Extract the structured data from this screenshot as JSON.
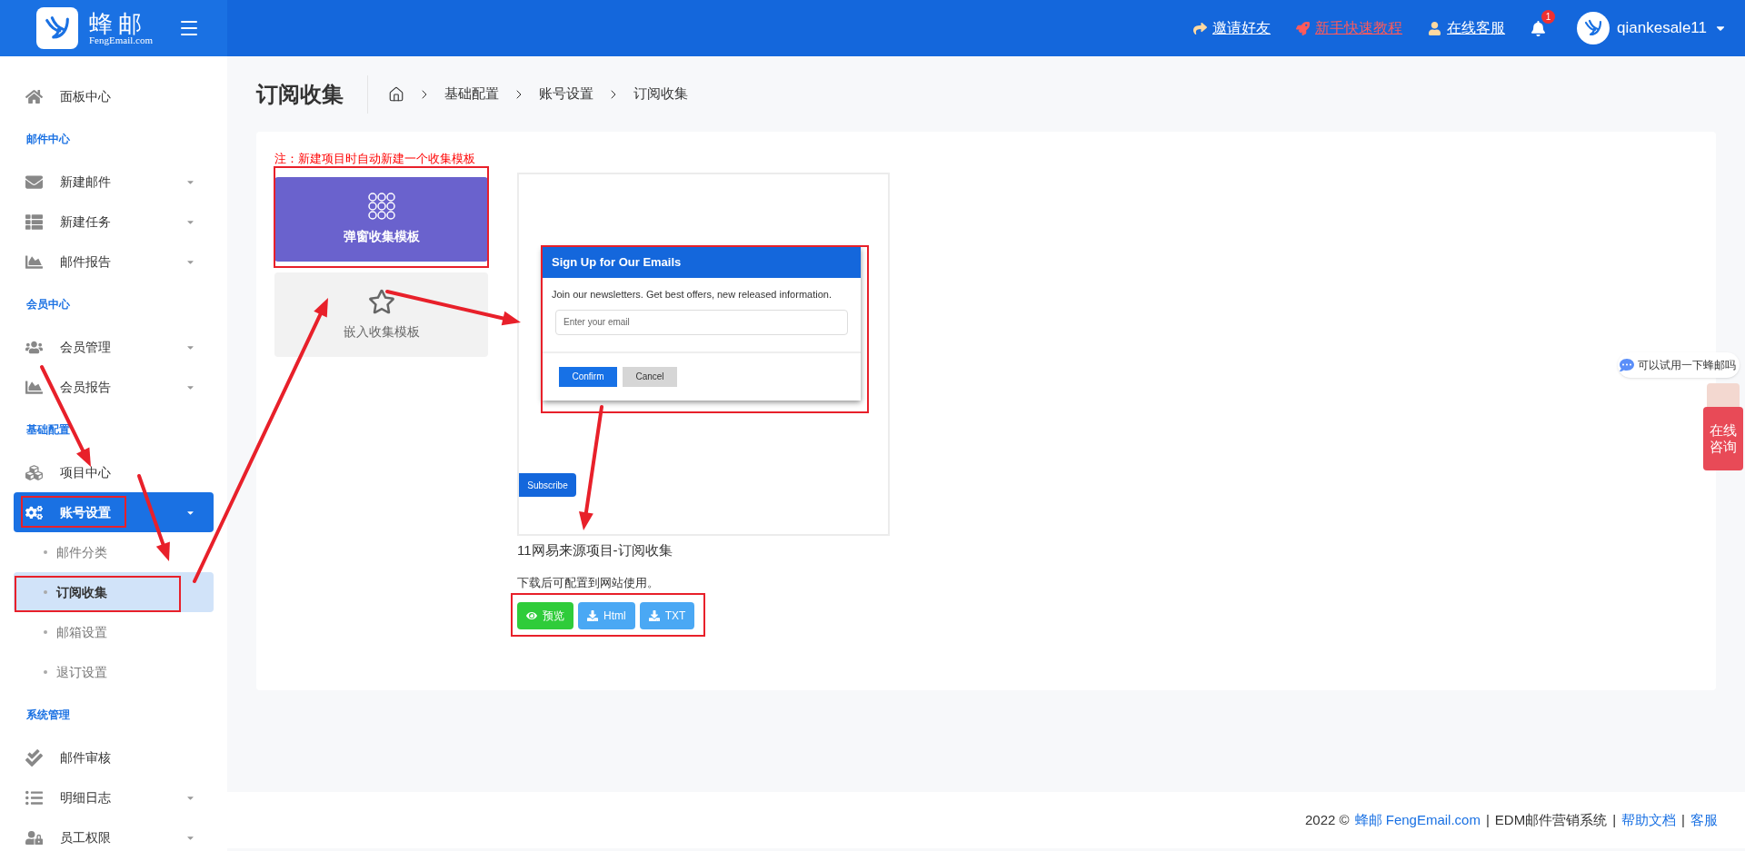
{
  "header": {
    "logo_title": "蜂邮",
    "logo_subtitle": "FengEmail.com",
    "links": [
      {
        "label": "邀请好友",
        "highlighted": false
      },
      {
        "label": "新手快速教程",
        "highlighted": true
      },
      {
        "label": "在线客服",
        "highlighted": false
      }
    ],
    "notification_count": "1",
    "user": "qiankesale11"
  },
  "sidebar": [
    {
      "kind": "link",
      "label": "面板中心",
      "selected": false,
      "has_caret": false
    },
    {
      "kind": "heading",
      "label": "邮件中心"
    },
    {
      "kind": "link",
      "label": "新建邮件",
      "selected": false,
      "has_caret": true
    },
    {
      "kind": "link",
      "label": "新建任务",
      "selected": false,
      "has_caret": true
    },
    {
      "kind": "link",
      "label": "邮件报告",
      "selected": false,
      "has_caret": true
    },
    {
      "kind": "heading",
      "label": "会员中心"
    },
    {
      "kind": "link",
      "label": "会员管理",
      "selected": false,
      "has_caret": true
    },
    {
      "kind": "link",
      "label": "会员报告",
      "selected": false,
      "has_caret": true
    },
    {
      "kind": "heading",
      "label": "基础配置"
    },
    {
      "kind": "link",
      "label": "项目中心",
      "selected": false,
      "has_caret": false
    },
    {
      "kind": "link",
      "label": "账号设置",
      "selected": true,
      "has_caret": true,
      "children": [
        {
          "label": "邮件分类",
          "selected": false
        },
        {
          "label": "订阅收集",
          "selected": true
        },
        {
          "label": "邮箱设置",
          "selected": false
        },
        {
          "label": "退订设置",
          "selected": false
        }
      ]
    },
    {
      "kind": "heading",
      "label": "系统管理"
    },
    {
      "kind": "link",
      "label": "邮件审核",
      "selected": false,
      "has_caret": false
    },
    {
      "kind": "link",
      "label": "明细日志",
      "selected": false,
      "has_caret": true
    },
    {
      "kind": "link",
      "label": "员工权限",
      "selected": false,
      "has_caret": true
    }
  ],
  "page": {
    "title": "订阅收集",
    "breadcrumb": [
      "基础配置",
      "账号设置",
      "订阅收集"
    ]
  },
  "note": "注：新建项目时自动新建一个收集模板",
  "templates": [
    {
      "label": "弹窗收集模板",
      "selected": true
    },
    {
      "label": "嵌入收集模板",
      "selected": false
    }
  ],
  "preview": {
    "popup_title": "Sign Up for Our Emails",
    "popup_text": "Join our newsletters. Get best offers, new released information.",
    "email_placeholder": "Enter your email",
    "confirm": "Confirm",
    "cancel": "Cancel",
    "subscribe": "Subscribe"
  },
  "project_title": "11网易来源项目-订阅收集",
  "project_description": "下载后可配置到网站使用。",
  "actions": [
    {
      "kind": "preview",
      "label": "预览"
    },
    {
      "kind": "download",
      "label": "Html"
    },
    {
      "kind": "download",
      "label": "TXT"
    }
  ],
  "footer": {
    "year": "2022 ©",
    "brand": "蜂邮 FengEmail.com",
    "separator_1": "|",
    "system": "EDM邮件营销系统",
    "separator_2": "|",
    "help": "帮助文档",
    "separator_3": "|",
    "service": "客服"
  },
  "chat": {
    "bubble": "可以试用一下蜂邮吗",
    "label": "在线咨询"
  }
}
